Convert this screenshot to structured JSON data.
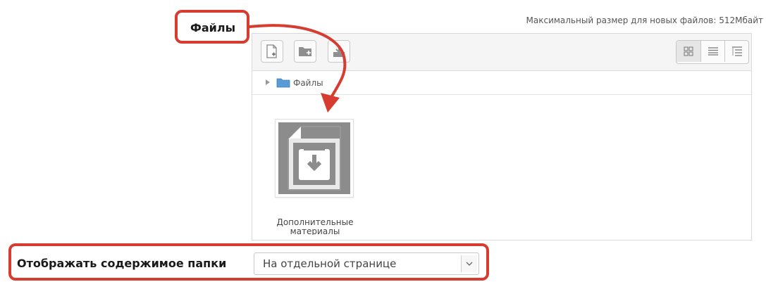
{
  "files_label": "Файлы",
  "max_size_text": "Максимальный размер для новых файлов: 512Мбайт",
  "toolbar": {
    "add_file_icon": "add-file-icon",
    "create_folder_icon": "create-folder-icon",
    "download_icon": "download-icon",
    "views": [
      "view-icons-icon",
      "view-list-icon",
      "view-tree-icon"
    ]
  },
  "path": {
    "folder_label": "Файлы"
  },
  "file": {
    "name_line1": "Дополнительные",
    "name_line2": "материалы"
  },
  "display": {
    "label": "Отображать содержимое папки",
    "selected": "На отдельной странице"
  },
  "colors": {
    "highlight": "#d63c2f",
    "toolbar_bg": "#f5f5f5",
    "thumb_gray": "#8c8c8c"
  }
}
